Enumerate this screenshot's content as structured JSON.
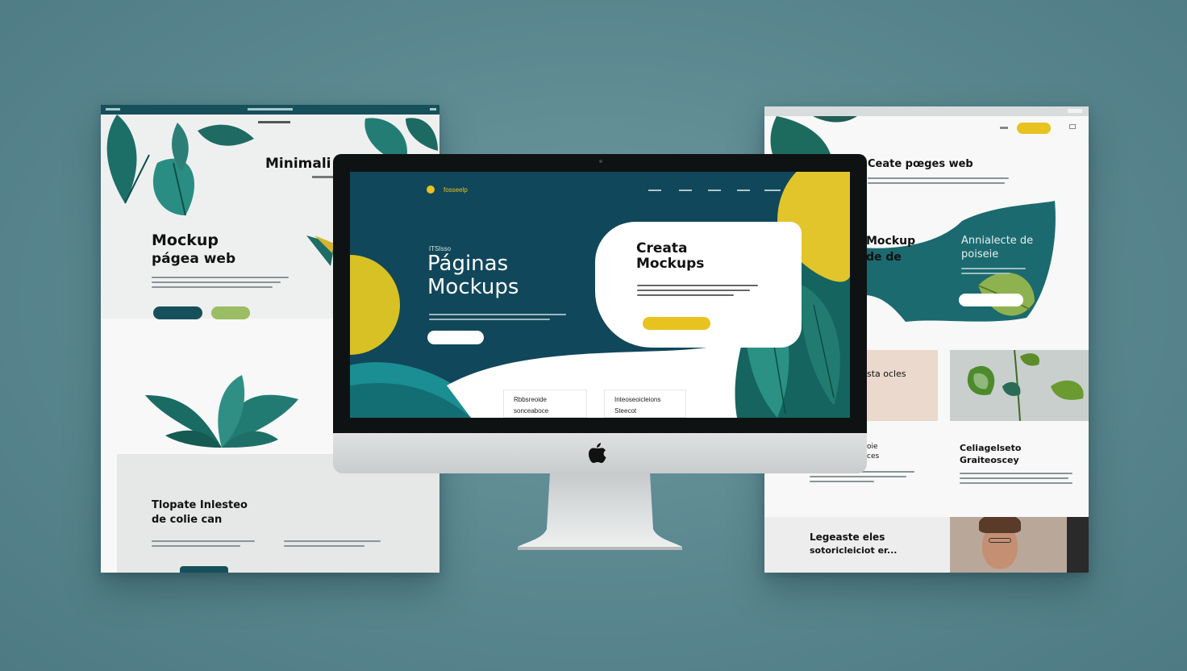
{
  "colors": {
    "background": "#5f8d95",
    "deep_teal": "#11475a",
    "teal": "#1c7f7a",
    "yellow": "#e8c21f",
    "olive_green": "#9bbd63",
    "dark_text": "#111111"
  },
  "left_page": {
    "nav_label": "Minimali",
    "hero_title_line1": "Mockup",
    "hero_title_line2": "págea web",
    "bottom_title_line1": "Tlopate Inlesteo",
    "bottom_title_line2": "de colie can"
  },
  "monitor": {
    "brand": "fosseelp",
    "eyebrow": "ITSIsso",
    "hero_title_line1": "Páginas",
    "hero_title_line2": "Mockups",
    "card_title_line1": "Creata",
    "card_title_line2": "Mockups",
    "tab1_line1": "Rbbsreoide",
    "tab1_line2": "sonceaboce",
    "tab2_line1": "Inteoseoicleions",
    "tab2_line2": "Steecot"
  },
  "right_page": {
    "hero_title": "Ceate pœges web",
    "mid_title_line1": "Mockup",
    "mid_title_line2": "de de",
    "banner_title_line1": "Annialecte de",
    "banner_title_line2": "poiseie",
    "beige_label": "sta ocles",
    "small_label_line1": "oie",
    "small_label_line2": "ces",
    "col_title_line1": "Celiagelseto",
    "col_title_line2": "Graiteoscey",
    "footer_title_line1": "Legeaste eles",
    "footer_title_line2": "sotoricleiciot er..."
  },
  "icons": [
    "apple-logo-icon",
    "leaf-plant-icon",
    "camera-icon"
  ]
}
